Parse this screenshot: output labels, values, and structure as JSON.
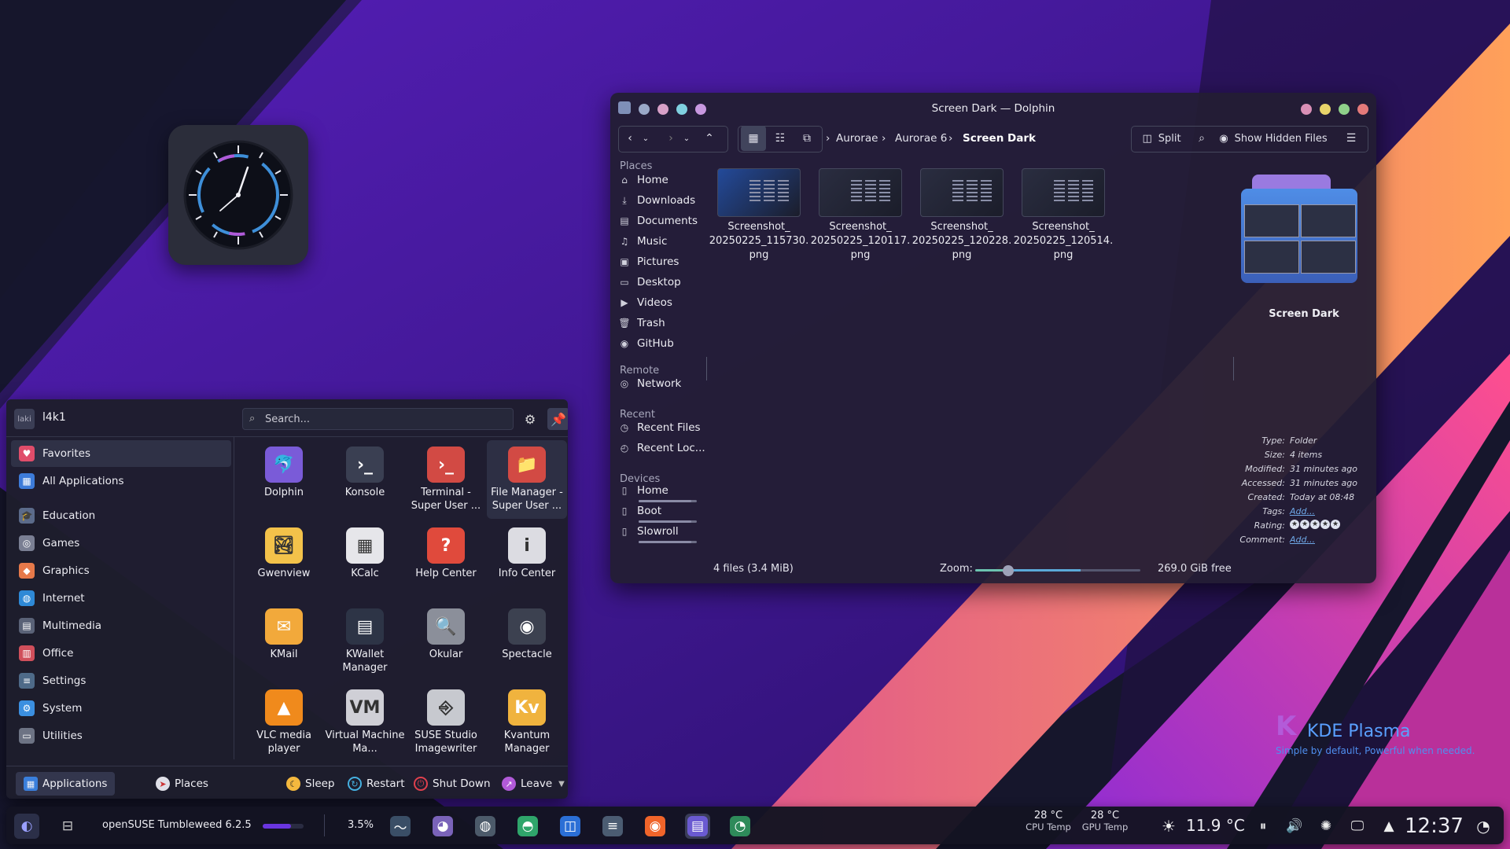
{
  "desktop": {
    "branding": {
      "title": "KDE Plasma",
      "tagline": "Simple by default, Powerful when needed."
    }
  },
  "launcher": {
    "user": {
      "avatar_text": "laki",
      "name": "l4k1"
    },
    "search_placeholder": "Search...",
    "categories": [
      {
        "label": "Favorites",
        "icon": "heart-icon",
        "color": "#e04d6a"
      },
      {
        "label": "All Applications",
        "icon": "grid-icon",
        "color": "#3d7bd9"
      },
      {
        "label": "Education",
        "icon": "graduation-cap-icon",
        "color": "#5b6b8a"
      },
      {
        "label": "Games",
        "icon": "gamepad-icon",
        "color": "#7a7f93"
      },
      {
        "label": "Graphics",
        "icon": "palette-icon",
        "color": "#e6794a"
      },
      {
        "label": "Internet",
        "icon": "globe-icon",
        "color": "#2e89d6"
      },
      {
        "label": "Multimedia",
        "icon": "film-icon",
        "color": "#5a6277"
      },
      {
        "label": "Office",
        "icon": "office-icon",
        "color": "#d04f5b"
      },
      {
        "label": "Settings",
        "icon": "sliders-icon",
        "color": "#4e6a88"
      },
      {
        "label": "System",
        "icon": "system-gear-icon",
        "color": "#3b8fe0"
      },
      {
        "label": "Utilities",
        "icon": "toolbox-icon",
        "color": "#6d7384"
      }
    ],
    "apps": [
      {
        "label": "Dolphin",
        "icon": "dolphin-icon",
        "bg": "#7a5bd8"
      },
      {
        "label": "Konsole",
        "icon": "terminal-icon",
        "bg": "#3a3f52"
      },
      {
        "label": "Terminal - Super User ...",
        "icon": "terminal-root-icon",
        "bg": "#d24a44"
      },
      {
        "label": "File Manager - Super User ...",
        "icon": "folder-root-icon",
        "bg": "#d24a44"
      },
      {
        "label": "Gwenview",
        "icon": "image-viewer-icon",
        "bg": "#f3c24a"
      },
      {
        "label": "KCalc",
        "icon": "calculator-icon",
        "bg": "#e6e6ea"
      },
      {
        "label": "Help Center",
        "icon": "help-icon",
        "bg": "#e04a3c"
      },
      {
        "label": "Info Center",
        "icon": "info-icon",
        "bg": "#dcdce2"
      },
      {
        "label": "KMail",
        "icon": "mail-icon",
        "bg": "#f2a93b"
      },
      {
        "label": "KWallet Manager",
        "icon": "wallet-icon",
        "bg": "#2d3446"
      },
      {
        "label": "Okular",
        "icon": "document-viewer-icon",
        "bg": "#8b8f9a"
      },
      {
        "label": "Spectacle",
        "icon": "screenshot-icon",
        "bg": "#3c4150"
      },
      {
        "label": "VLC media player",
        "icon": "vlc-cone-icon",
        "bg": "#f08a1c"
      },
      {
        "label": "Virtual Machine Ma...",
        "icon": "virtual-machine-icon",
        "bg": "#cfcfd6"
      },
      {
        "label": "SUSE Studio Imagewriter",
        "icon": "usb-writer-icon",
        "bg": "#c7c9cf"
      },
      {
        "label": "Kvantum Manager",
        "icon": "kvantum-icon",
        "bg": "#f0b33e"
      }
    ],
    "icon_glyphs": [
      "🐬",
      "›_",
      "›_",
      "📁",
      "🏞",
      "▦",
      "?",
      "i",
      "✉",
      "▤",
      "🔍",
      "◉",
      "▲",
      "VM",
      "⎆",
      "Kv"
    ],
    "footer": {
      "applications": "Applications",
      "places": "Places",
      "sleep": "Sleep",
      "restart": "Restart",
      "shutdown": "Shut Down",
      "leave": "Leave"
    }
  },
  "dolphin": {
    "window_title": "Screen Dark — Dolphin",
    "breadcrumb": [
      "Aurorae",
      "Aurorae 6",
      "Screen Dark"
    ],
    "toolbar": {
      "split": "Split",
      "show_hidden": "Show Hidden Files"
    },
    "places": {
      "sections": {
        "places": "Places",
        "remote": "Remote",
        "recent": "Recent",
        "devices": "Devices"
      },
      "places_items": [
        {
          "label": "Home",
          "icon": "home-icon"
        },
        {
          "label": "Downloads",
          "icon": "download-icon"
        },
        {
          "label": "Documents",
          "icon": "documents-icon"
        },
        {
          "label": "Music",
          "icon": "music-icon"
        },
        {
          "label": "Pictures",
          "icon": "pictures-icon"
        },
        {
          "label": "Desktop",
          "icon": "desktop-icon"
        },
        {
          "label": "Videos",
          "icon": "videos-icon"
        },
        {
          "label": "Trash",
          "icon": "trash-icon"
        },
        {
          "label": "GitHub",
          "icon": "github-icon"
        }
      ],
      "remote_items": [
        {
          "label": "Network",
          "icon": "network-icon"
        }
      ],
      "recent_items": [
        {
          "label": "Recent Files",
          "icon": "recent-files-icon"
        },
        {
          "label": "Recent Loc...",
          "icon": "recent-locations-icon"
        }
      ],
      "device_items": [
        {
          "label": "Home",
          "icon": "drive-icon",
          "usage": 0.9
        },
        {
          "label": "Boot",
          "icon": "drive-icon",
          "usage": 0.9
        },
        {
          "label": "Slowroll",
          "icon": "drive-icon",
          "usage": 0.9
        }
      ]
    },
    "files": [
      {
        "name_line1": "Screenshot_",
        "name_line2": "20250225_115730.",
        "name_line3": "png"
      },
      {
        "name_line1": "Screenshot_",
        "name_line2": "20250225_120117.",
        "name_line3": "png"
      },
      {
        "name_line1": "Screenshot_",
        "name_line2": "20250225_120228.",
        "name_line3": "png"
      },
      {
        "name_line1": "Screenshot_",
        "name_line2": "20250225_120514.",
        "name_line3": "png"
      }
    ],
    "info_panel": {
      "name": "Screen Dark",
      "rows": [
        {
          "label": "Type:",
          "value": "Folder"
        },
        {
          "label": "Size:",
          "value": "4 items"
        },
        {
          "label": "Modified:",
          "value": "31 minutes ago"
        },
        {
          "label": "Accessed:",
          "value": "31 minutes ago"
        },
        {
          "label": "Created:",
          "value": "Today at 08:48"
        }
      ],
      "tags_label": "Tags:",
      "tags_value": "Add...",
      "rating_label": "Rating:",
      "rating": 5,
      "comment_label": "Comment:",
      "comment_value": "Add..."
    },
    "status": {
      "files": "4 files (3.4 MiB)",
      "zoom_label": "Zoom:",
      "zoom": 0.2,
      "free": "269.0 GiB free"
    }
  },
  "taskbar": {
    "os_label": "openSUSE Tumbleweed 6.2.5",
    "cpu_percent": "3.5%",
    "tasks": [
      {
        "icon": "system-monitor-icon",
        "bg": "#3a4e66"
      },
      {
        "icon": "gecko-icon",
        "bg": "#7a63b9"
      },
      {
        "icon": "browser-globe-icon",
        "bg": "#4c5a6a"
      },
      {
        "icon": "elephant-icon",
        "bg": "#2fa56b"
      },
      {
        "icon": "shopping-bag-icon",
        "bg": "#2b6fd6"
      },
      {
        "icon": "settings-sliders-icon",
        "bg": "#4b5c72"
      },
      {
        "icon": "firefox-icon",
        "bg": "#f0642a"
      },
      {
        "icon": "dolphin-task-icon",
        "bg": "#6a5ad1"
      },
      {
        "icon": "pie-monitor-icon",
        "bg": "#2e8a5a"
      }
    ],
    "cpu_temp": {
      "value": "28 °C",
      "label": "CPU Temp"
    },
    "gpu_temp": {
      "value": "28 °C",
      "label": "GPU Temp"
    },
    "weather": "11.9 °C",
    "time": "12:37"
  }
}
